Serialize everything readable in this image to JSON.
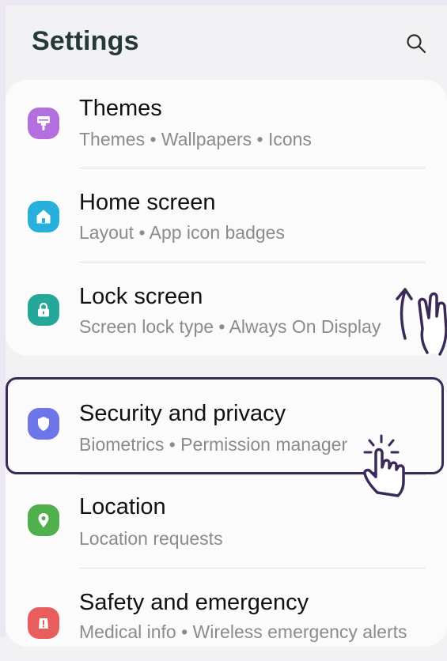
{
  "header": {
    "title": "Settings",
    "search_icon": "search-icon"
  },
  "items": [
    {
      "title": "Themes",
      "subtitle": "Themes  •  Wallpapers  •  Icons",
      "icon": "brush-icon",
      "color": "#b46fdf"
    },
    {
      "title": "Home screen",
      "subtitle": "Layout  •  App icon badges",
      "icon": "home-icon",
      "color": "#27b0dc"
    },
    {
      "title": "Lock screen",
      "subtitle": "Screen lock type  •  Always On Display",
      "icon": "lock-icon",
      "color": "#27a79a"
    },
    {
      "title": "Security and privacy",
      "subtitle": "Biometrics  •  Permission manager",
      "icon": "shield-icon",
      "color": "#6d75e8"
    },
    {
      "title": "Location",
      "subtitle": "Location requests",
      "icon": "location-pin-icon",
      "color": "#4fb04d"
    },
    {
      "title": "Safety and emergency",
      "subtitle": "Medical info  •  Wireless emergency alerts",
      "icon": "alert-icon",
      "color": "#e85d5d"
    }
  ],
  "overlays": {
    "swipe_hint_icon": "swipe-up-gesture-icon",
    "tap_hint_icon": "tap-gesture-icon",
    "highlight_color": "#3a2a58"
  }
}
